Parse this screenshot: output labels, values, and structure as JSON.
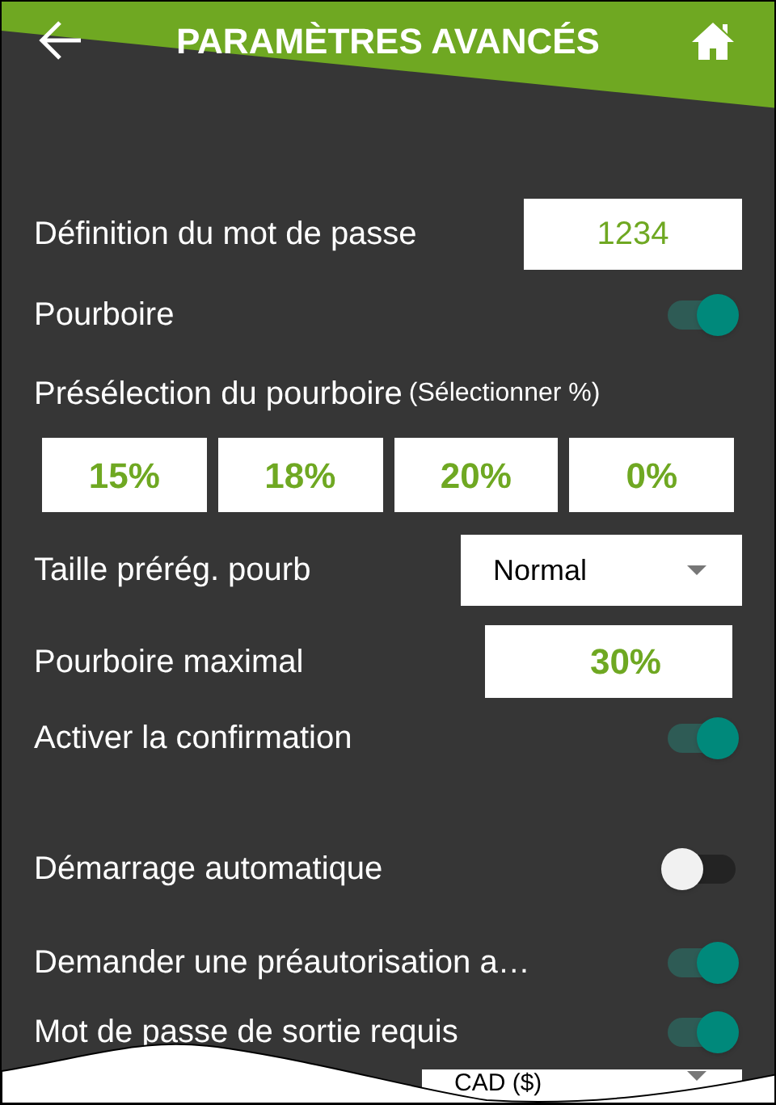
{
  "header": {
    "title": "PARAMÈTRES AVANCÉS"
  },
  "settings": [
    {
      "kind": "field",
      "label": "Définition du mot de passe",
      "value": "1234"
    },
    {
      "kind": "toggle",
      "label": "Pourboire",
      "on": true
    },
    {
      "kind": "presets",
      "label": "Présélection du pourboire",
      "hint": "(Sélectionner %)",
      "options": [
        "15%",
        "18%",
        "20%",
        "0%"
      ]
    },
    {
      "kind": "dropdown",
      "label": "Taille prérég. pourb",
      "value": "Normal"
    },
    {
      "kind": "field",
      "label": "Pourboire maximal",
      "value": "30%"
    },
    {
      "kind": "toggle",
      "label": "Activer la confirmation",
      "on": true
    },
    {
      "kind": "toggle",
      "label": "Démarrage automatique",
      "on": false
    },
    {
      "kind": "toggle",
      "label": "Demander une préautorisation a…",
      "on": true
    },
    {
      "kind": "toggle",
      "label": "Mot de passe de sortie requis",
      "on": true
    },
    {
      "kind": "dropdown",
      "value": "CAD ($)"
    }
  ]
}
